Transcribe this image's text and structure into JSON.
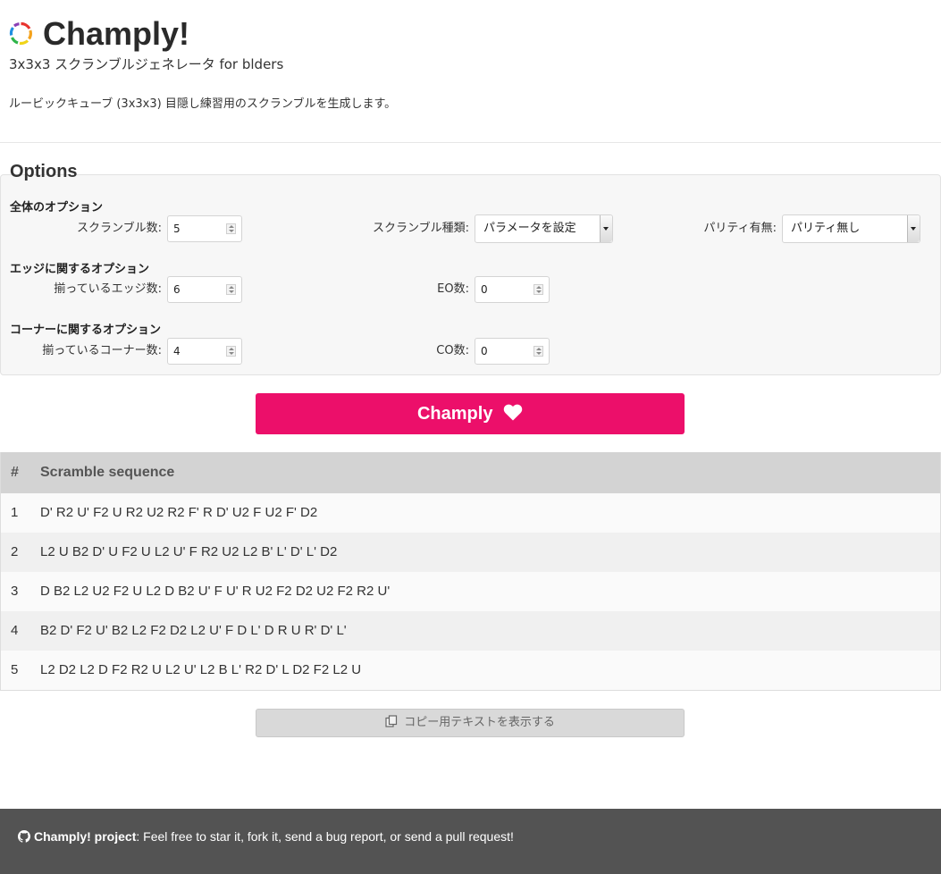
{
  "header": {
    "title": "Champly!",
    "subtitle": "3x3x3 スクランブルジェネレータ for blders",
    "description": "ルービックキューブ (3x3x3) 目隠し練習用のスクランブルを生成します。"
  },
  "options": {
    "title": "Options",
    "general": {
      "heading": "全体のオプション",
      "scramble_count_label": "スクランブル数:",
      "scramble_count_value": "5",
      "scramble_type_label": "スクランブル種類:",
      "scramble_type_value": "パラメータを設定",
      "parity_label": "パリティ有無:",
      "parity_value": "パリティ無し"
    },
    "edge": {
      "heading": "エッジに関するオプション",
      "solved_edges_label": "揃っているエッジ数:",
      "solved_edges_value": "6",
      "eo_label": "EO数:",
      "eo_value": "0"
    },
    "corner": {
      "heading": "コーナーに関するオプション",
      "solved_corners_label": "揃っているコーナー数:",
      "solved_corners_value": "4",
      "co_label": "CO数:",
      "co_value": "0"
    }
  },
  "generate_button": {
    "label": "Champly"
  },
  "table": {
    "headers": [
      "#",
      "Scramble sequence"
    ],
    "rows": [
      {
        "num": "1",
        "seq": "D' R2 U' F2 U R2 U2 R2 F' R D' U2 F U2 F' D2"
      },
      {
        "num": "2",
        "seq": "L2 U B2 D' U F2 U L2 U' F R2 U2 L2 B' L' D' L' D2"
      },
      {
        "num": "3",
        "seq": "D B2 L2 U2 F2 U L2 D B2 U' F U' R U2 F2 D2 U2 F2 R2 U'"
      },
      {
        "num": "4",
        "seq": "B2 D' F2 U' B2 L2 F2 D2 L2 U' F D L' D R U R' D' L'"
      },
      {
        "num": "5",
        "seq": "L2 D2 L2 D F2 R2 U L2 U' L2 B L' R2 D' L D2 F2 L2 U"
      }
    ]
  },
  "copy_button": {
    "label": "コピー用テキストを表示する"
  },
  "footer": {
    "link_text": "Champly! project",
    "text": ": Feel free to star it, fork it, send a bug report, or send a pull request!"
  },
  "colors": {
    "accent": "#ec0f6a",
    "footer_bg": "#535353",
    "table_header_bg": "#d3d3d3"
  },
  "icons": {
    "logo": "color-ring-logo-icon",
    "heart": "heart-icon",
    "copy": "copy-icon",
    "github": "github-icon"
  }
}
